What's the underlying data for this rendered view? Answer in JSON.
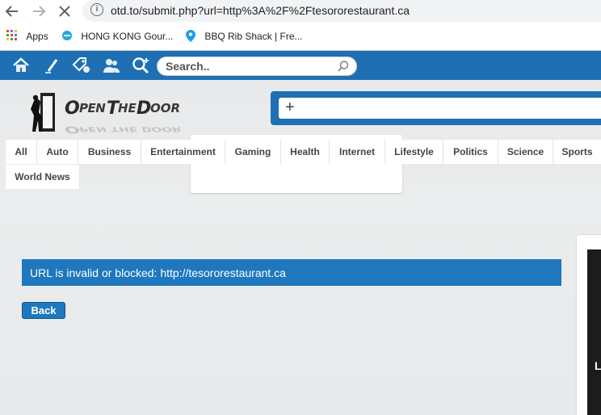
{
  "browser": {
    "url": "otd.to/submit.php?url=http%3A%2F%2Ftesororestaurant.ca",
    "bookmarks": [
      {
        "label": "Apps",
        "icon": "apps-grid-icon"
      },
      {
        "label": "HONG KONG Gour...",
        "icon": "site-favicon"
      },
      {
        "label": "BBQ Rib Shack | Fre...",
        "icon": "location-pin-icon"
      }
    ]
  },
  "site": {
    "toolbar_icons": [
      "home-icon",
      "pencil-icon",
      "tags-icon",
      "users-icon",
      "add-search-icon"
    ],
    "search": {
      "placeholder": "Search.."
    },
    "logo_text": "OpenTheDoor",
    "categories": [
      "All",
      "Auto",
      "Business",
      "Entertainment",
      "Gaming",
      "Health",
      "Internet",
      "Lifestyle",
      "Politics",
      "Science",
      "Sports",
      "World News"
    ],
    "side_card_letter": "L",
    "alert_message": "URL is invalid or blocked: http://tesororestaurant.ca",
    "back_label": "Back"
  },
  "colors": {
    "brand_blue": "#1e6fb3",
    "alert_blue": "#1f78be"
  }
}
